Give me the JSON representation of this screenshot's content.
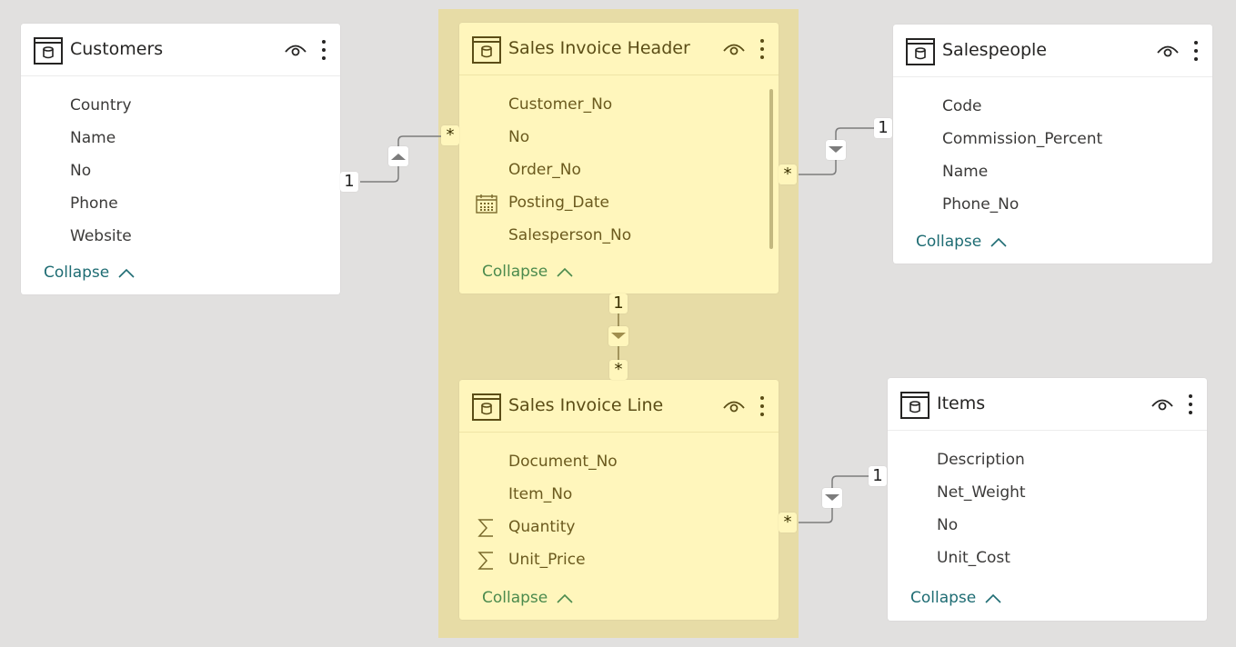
{
  "tables": {
    "customers": {
      "title": "Customers",
      "fields": [
        {
          "name": "Country",
          "icon": ""
        },
        {
          "name": "Name",
          "icon": ""
        },
        {
          "name": "No",
          "icon": ""
        },
        {
          "name": "Phone",
          "icon": ""
        },
        {
          "name": "Website",
          "icon": ""
        }
      ],
      "collapse_label": "Collapse",
      "highlighted": false
    },
    "sales_invoice_header": {
      "title": "Sales Invoice Header",
      "fields": [
        {
          "name": "Customer_No",
          "icon": ""
        },
        {
          "name": "No",
          "icon": ""
        },
        {
          "name": "Order_No",
          "icon": ""
        },
        {
          "name": "Posting_Date",
          "icon": "calendar-icon"
        },
        {
          "name": "Salesperson_No",
          "icon": ""
        }
      ],
      "collapse_label": "Collapse",
      "highlighted": true
    },
    "salespeople": {
      "title": "Salespeople",
      "fields": [
        {
          "name": "Code",
          "icon": ""
        },
        {
          "name": "Commission_Percent",
          "icon": ""
        },
        {
          "name": "Name",
          "icon": ""
        },
        {
          "name": "Phone_No",
          "icon": ""
        }
      ],
      "collapse_label": "Collapse",
      "highlighted": false
    },
    "sales_invoice_line": {
      "title": "Sales Invoice Line",
      "fields": [
        {
          "name": "Document_No",
          "icon": ""
        },
        {
          "name": "Item_No",
          "icon": ""
        },
        {
          "name": "Quantity",
          "icon": "sigma-icon"
        },
        {
          "name": "Unit_Price",
          "icon": "sigma-icon"
        }
      ],
      "collapse_label": "Collapse",
      "highlighted": true
    },
    "items": {
      "title": "Items",
      "fields": [
        {
          "name": "Description",
          "icon": ""
        },
        {
          "name": "Net_Weight",
          "icon": ""
        },
        {
          "name": "No",
          "icon": ""
        },
        {
          "name": "Unit_Cost",
          "icon": ""
        }
      ],
      "collapse_label": "Collapse",
      "highlighted": false
    }
  },
  "relationships": [
    {
      "from": "Customers",
      "to": "Sales Invoice Header",
      "one_side": "1",
      "many_side": "*",
      "filter_direction": "up"
    },
    {
      "from": "Salespeople",
      "to": "Sales Invoice Header",
      "one_side": "1",
      "many_side": "*",
      "filter_direction": "down"
    },
    {
      "from": "Sales Invoice Header",
      "to": "Sales Invoice Line",
      "one_side": "1",
      "many_side": "*",
      "filter_direction": "down"
    },
    {
      "from": "Items",
      "to": "Sales Invoice Line",
      "one_side": "1",
      "many_side": "*",
      "filter_direction": "down"
    }
  ],
  "colors": {
    "canvas": "#e1e0df",
    "highlight_group": "#e7dca6",
    "highlight_card": "#fff6bc",
    "collapse_link": "#1e6c73",
    "collapse_link_highlighted": "#4b8a4d"
  }
}
